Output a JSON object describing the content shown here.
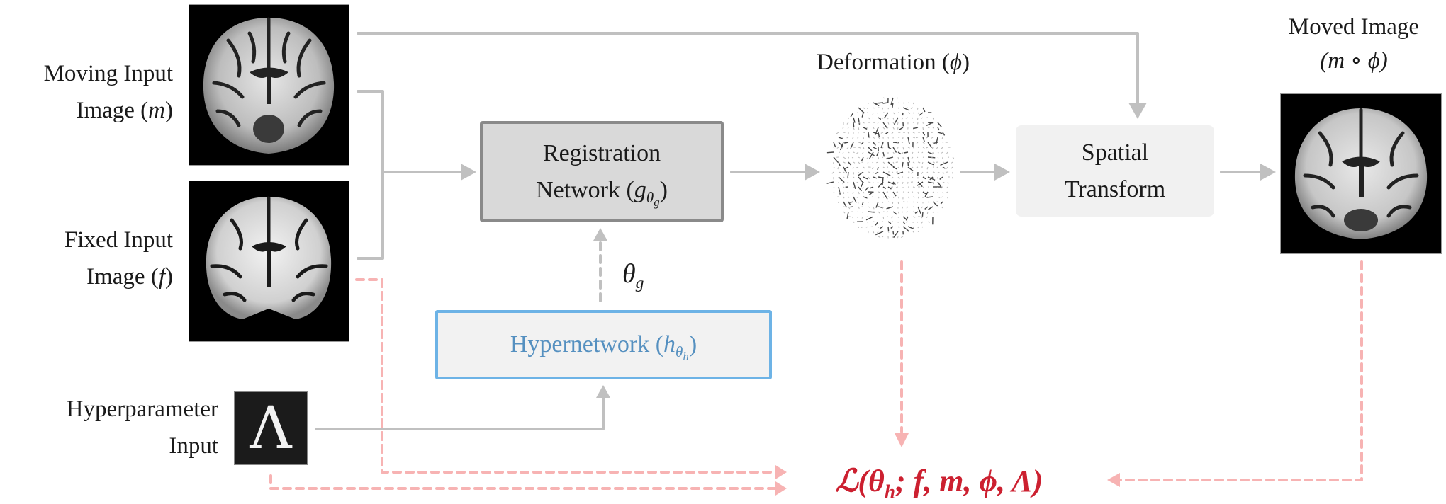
{
  "inputs": {
    "moving": {
      "line1": "Moving Input",
      "line2_prefix": "Image (",
      "symbol": "m",
      "line2_suffix": ")"
    },
    "fixed": {
      "line1": "Fixed Input",
      "line2_prefix": "Image (",
      "symbol": "f",
      "line2_suffix": ")"
    },
    "hyperparameter": {
      "line1": "Hyperparameter",
      "line2": "Input",
      "symbol": "Λ"
    }
  },
  "nodes": {
    "registration": {
      "line1": "Registration",
      "line2_prefix": "Network (",
      "fn": "g",
      "sub": "θ",
      "subsub": "g",
      "line2_suffix": ")"
    },
    "hypernetwork": {
      "prefix": "Hypernetwork (",
      "fn": "h",
      "sub": "θ",
      "subsub": "h",
      "suffix": ")"
    },
    "spatial_transform": {
      "line1": "Spatial",
      "line2": "Transform"
    }
  },
  "edge_labels": {
    "theta_g": {
      "symbol": "θ",
      "sub": "g"
    }
  },
  "outputs": {
    "deformation": {
      "prefix": "Deformation (",
      "symbol": "ϕ",
      "suffix": ")"
    },
    "moved": {
      "line1": "Moved Image",
      "line2": "(m ∘ ϕ)"
    }
  },
  "loss": {
    "prefix": "ℒ(",
    "theta": "θ",
    "sub": "h",
    "rest": "; f, m, ϕ, Λ)"
  },
  "colors": {
    "flow_line": "#c0c0c0",
    "loss_line": "#f7b3b3",
    "loss_text": "#cc2030",
    "hypernetwork_border": "#6db3e6",
    "hypernetwork_text": "#5590c0",
    "registration_fill": "#d9d9d9",
    "registration_border": "#8a8a8a"
  }
}
